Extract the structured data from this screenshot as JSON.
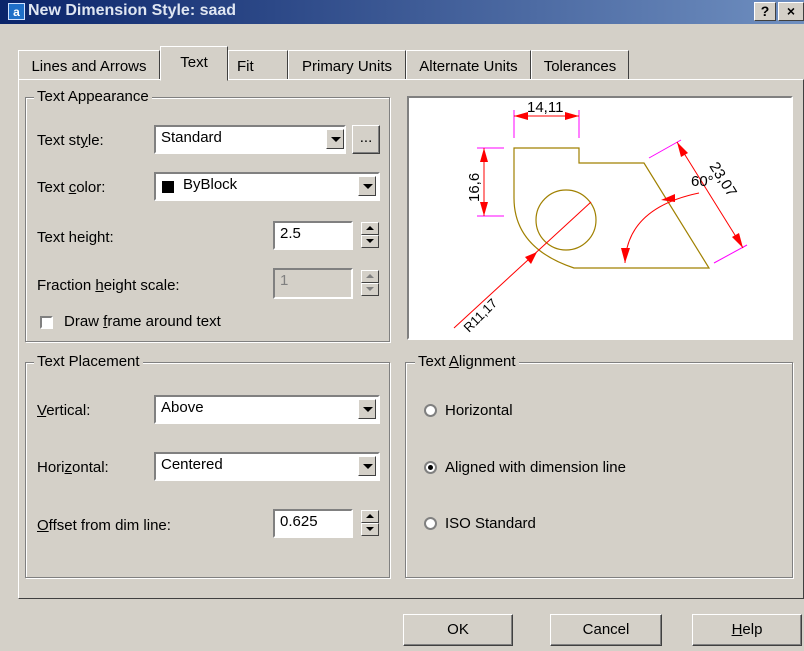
{
  "window": {
    "title": "New Dimension Style: saad",
    "help_glyph": "?",
    "close_glyph": "×",
    "icon_glyph": "a"
  },
  "tabs": [
    {
      "label": "Lines and Arrows"
    },
    {
      "label": "Text"
    },
    {
      "label": "Fit"
    },
    {
      "label": "Primary Units"
    },
    {
      "label": "Alternate Units"
    },
    {
      "label": "Tolerances"
    }
  ],
  "active_tab": "Text",
  "text_appearance": {
    "legend": "Text Appearance",
    "style_label_pre": "Text st",
    "style_label_u": "y",
    "style_label_post": "le:",
    "style_value": "Standard",
    "browse_label": "...",
    "color_label_pre": "Text ",
    "color_label_u": "c",
    "color_label_post": "olor:",
    "color_value": "ByBlock",
    "color_swatch": "#000000",
    "height_label_pre": "Text hei",
    "height_label_u": "g",
    "height_label_post": "ht:",
    "height_value": "2.5",
    "fraction_label_pre": "Fraction ",
    "fraction_label_u": "h",
    "fraction_label_post": "eight scale:",
    "fraction_value": "1",
    "frame_label_pre": "Draw ",
    "frame_label_u": "f",
    "frame_label_post": "rame around text",
    "frame_checked": false
  },
  "text_placement": {
    "legend": "Text Placement",
    "vertical_label_pre": "",
    "vertical_label_u": "V",
    "vertical_label_post": "ertical:",
    "vertical_value": "Above",
    "horizontal_label_pre": "Hori",
    "horizontal_label_u": "z",
    "horizontal_label_post": "ontal:",
    "horizontal_value": "Centered",
    "offset_label_pre": "",
    "offset_label_u": "O",
    "offset_label_post": "ffset from dim line:",
    "offset_value": "0.625"
  },
  "text_alignment": {
    "legend_pre": "Text ",
    "legend_u": "A",
    "legend_post": "lignment",
    "options": [
      {
        "label": "Horizontal",
        "checked": false
      },
      {
        "label": "Aligned with dimension line",
        "checked": true
      },
      {
        "label": "ISO Standard",
        "checked": false
      }
    ]
  },
  "preview": {
    "dim_top": "14,11",
    "dim_left": "16,6",
    "dim_radius": "R11,17",
    "dim_angle": "60°",
    "dim_slant": "23,07",
    "colors": {
      "dimension": "#ff0000",
      "geometry": "#a08000",
      "extension": "#ff00ff"
    }
  },
  "buttons": {
    "ok": "OK",
    "cancel": "Cancel",
    "help_pre": "",
    "help_u": "H",
    "help_post": "elp"
  }
}
